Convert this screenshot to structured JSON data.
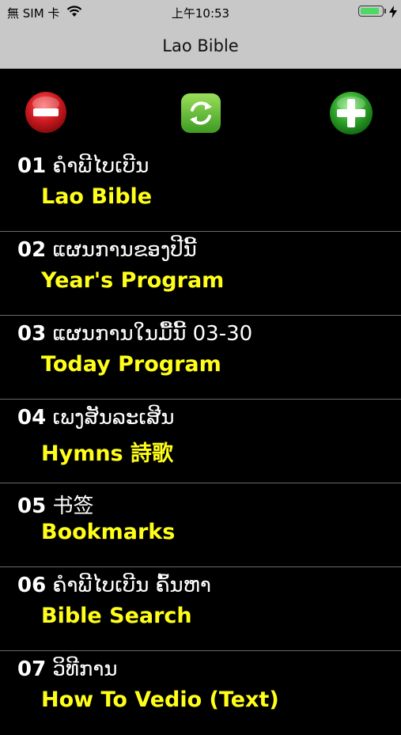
{
  "status_bar": {
    "carrier": "無 SIM 卡",
    "time": "上午10:53",
    "battery_percent": 90,
    "icons": [
      "wifi-icon",
      "battery-icon",
      "charging-icon"
    ]
  },
  "nav": {
    "title": "Lao Bible"
  },
  "toolbar": {
    "remove_icon": "minus-circle-icon",
    "refresh_icon": "refresh-icon",
    "add_icon": "plus-circle-icon",
    "colors": {
      "remove": "#c0171d",
      "refresh": "#5fb53c",
      "add": "#33a52d"
    }
  },
  "menu": {
    "items": [
      {
        "num": "01",
        "title": "ຄຳພີໄບເບີນ",
        "subtitle": "Lao Bible"
      },
      {
        "num": "02",
        "title": "ແຜນການຂອງປີນີ້",
        "subtitle": "Year's Program"
      },
      {
        "num": "03",
        "title": "ແຜນການໃນມື້ນີ້  03-30",
        "subtitle": "Today Program"
      },
      {
        "num": "04",
        "title": "ເພງສັນລະເສີນ",
        "subtitle": "Hymns 詩歌"
      },
      {
        "num": "05",
        "title": "书签",
        "subtitle": "Bookmarks"
      },
      {
        "num": "06",
        "title": "ຄຳພີໄບເບີນ ຄົ້ນຫາ",
        "subtitle": "Bible Search"
      },
      {
        "num": "07",
        "title": "ວິທີການ",
        "subtitle": "How To Vedio (Text)"
      }
    ],
    "colors": {
      "title": "#ffffff",
      "subtitle": "#ffff1a",
      "background": "#000000"
    }
  }
}
